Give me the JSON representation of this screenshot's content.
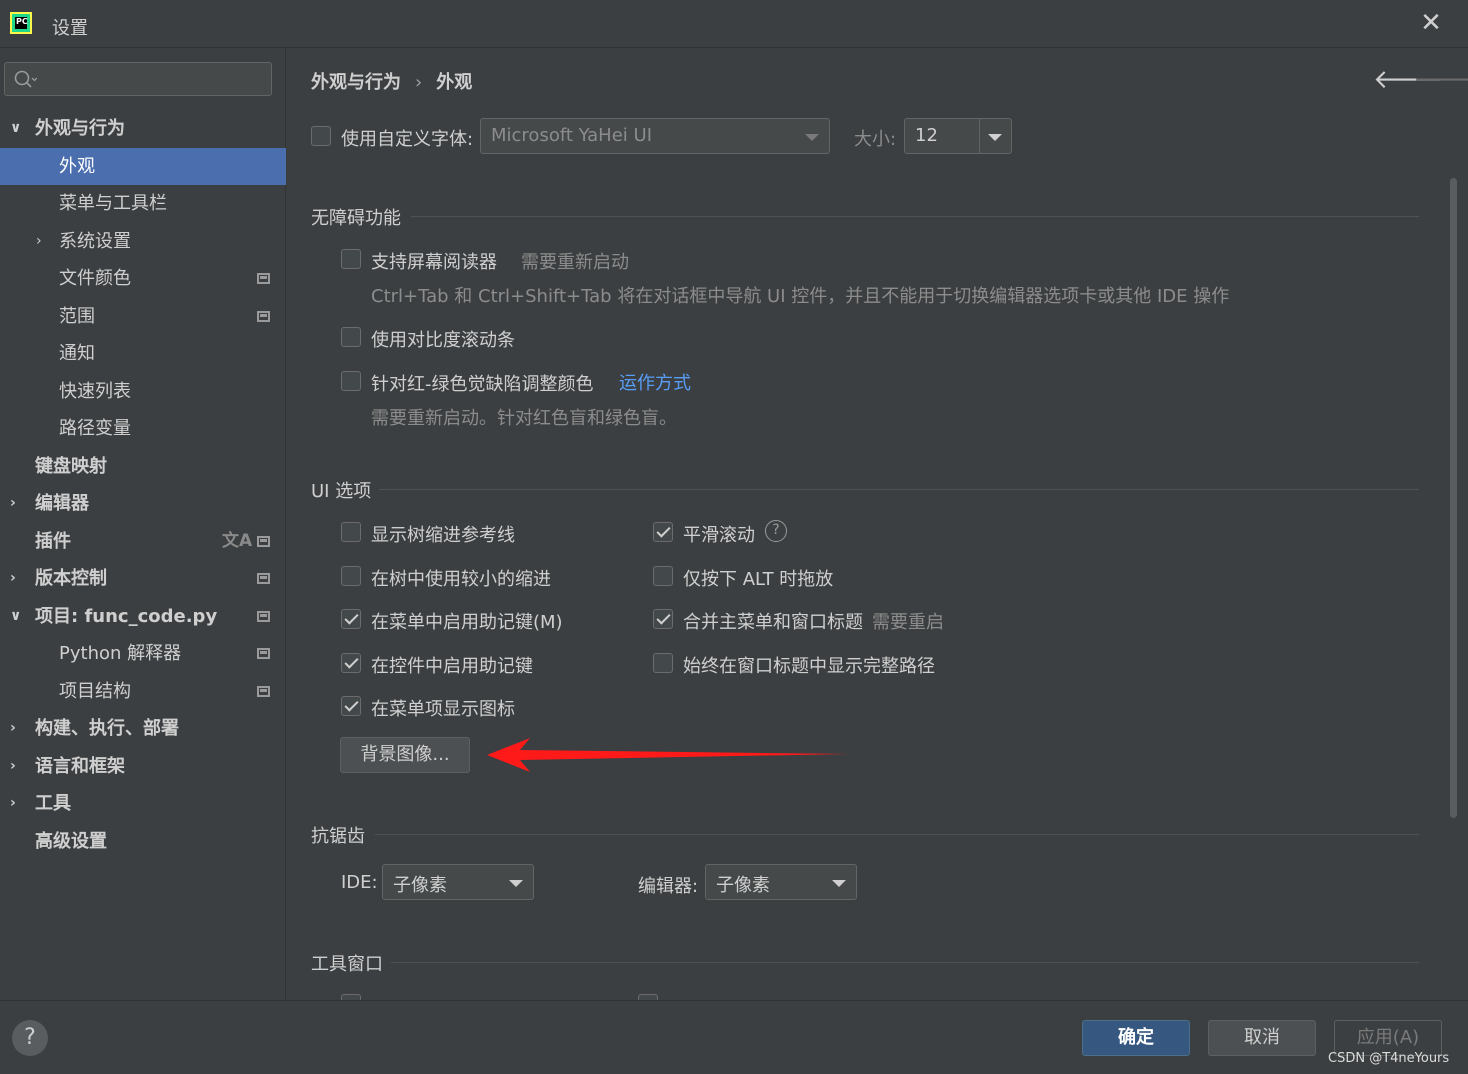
{
  "window": {
    "title": "设置",
    "close_glyph": "✕"
  },
  "sidebar": {
    "search_placeholder": "",
    "items": [
      {
        "label": "外观与行为",
        "chevron": "∨",
        "bold": true
      },
      {
        "label": "外观",
        "selected": true
      },
      {
        "label": "菜单与工具栏"
      },
      {
        "label": "系统设置",
        "chevron": "›"
      },
      {
        "label": "文件颜色",
        "badge": true
      },
      {
        "label": "范围",
        "badge": true
      },
      {
        "label": "通知"
      },
      {
        "label": "快速列表"
      },
      {
        "label": "路径变量"
      },
      {
        "label": "键盘映射",
        "bold": true
      },
      {
        "label": "编辑器",
        "chevron": "›",
        "bold": true
      },
      {
        "label": "插件",
        "bold": true,
        "badge": true,
        "translate_icon": "文A"
      },
      {
        "label": "版本控制",
        "chevron": "›",
        "bold": true,
        "badge": true
      },
      {
        "label": "项目: func_code.py",
        "chevron": "∨",
        "bold": true,
        "badge": true
      },
      {
        "label": "Python 解释器",
        "badge": true
      },
      {
        "label": "项目结构",
        "badge": true
      },
      {
        "label": "构建、执行、部署",
        "chevron": "›",
        "bold": true
      },
      {
        "label": "语言和框架",
        "chevron": "›",
        "bold": true
      },
      {
        "label": "工具",
        "chevron": "›",
        "bold": true
      },
      {
        "label": "高级设置",
        "bold": true
      }
    ]
  },
  "main": {
    "breadcrumb": {
      "parent": "外观与行为",
      "separator": "›",
      "current": "外观"
    },
    "nav": {
      "back": "🡐",
      "forward": "🡒"
    },
    "font": {
      "checkbox_label": "使用自定义字体:",
      "font_value": "Microsoft YaHei UI",
      "size_label": "大小:",
      "size_value": "12"
    },
    "accessibility": {
      "title": "无障碍功能",
      "screen_reader": "支持屏幕阅读器",
      "screen_reader_note": "需要重新启动",
      "screen_reader_desc": "Ctrl+Tab 和 Ctrl+Shift+Tab 将在对话框中导航 UI 控件，并且不能用于切换编辑器选项卡或其他 IDE 操作",
      "contrast_scrollbars": "使用对比度滚动条",
      "color_deficiency": "针对红-绿色觉缺陷调整颜色",
      "how_it_works": "运作方式",
      "color_deficiency_desc": "需要重新启动。针对红色盲和绿色盲。"
    },
    "ui_options": {
      "title": "UI 选项",
      "tree_guides": "显示树缩进参考线",
      "smaller_indent": "在树中使用较小的缩进",
      "menu_mnemonics": "在菜单中启用助记键(M)",
      "control_mnemonics": "在控件中启用助记键",
      "menu_icons": "在菜单项显示图标",
      "smooth_scroll": "平滑滚动",
      "alt_drag": "仅按下 ALT 时拖放",
      "merge_title": "合并主菜单和窗口标题",
      "merge_title_note": "需要重启",
      "full_path": "始终在窗口标题中显示完整路径",
      "background_button": "背景图像..."
    },
    "antialiasing": {
      "title": "抗锯齿",
      "ide_label": "IDE:",
      "ide_value": "子像素",
      "editor_label": "编辑器:",
      "editor_value": "子像素"
    },
    "tool_windows": {
      "title": "工具窗口"
    }
  },
  "footer": {
    "help": "?",
    "ok": "确定",
    "cancel": "取消",
    "apply": "应用(A)",
    "watermark": "CSDN @T4neYours"
  },
  "colors": {
    "accent": "#4b6eaf",
    "ok_button": "#365880",
    "link": "#589df6",
    "annotation_arrow": "#ff1a1a"
  }
}
